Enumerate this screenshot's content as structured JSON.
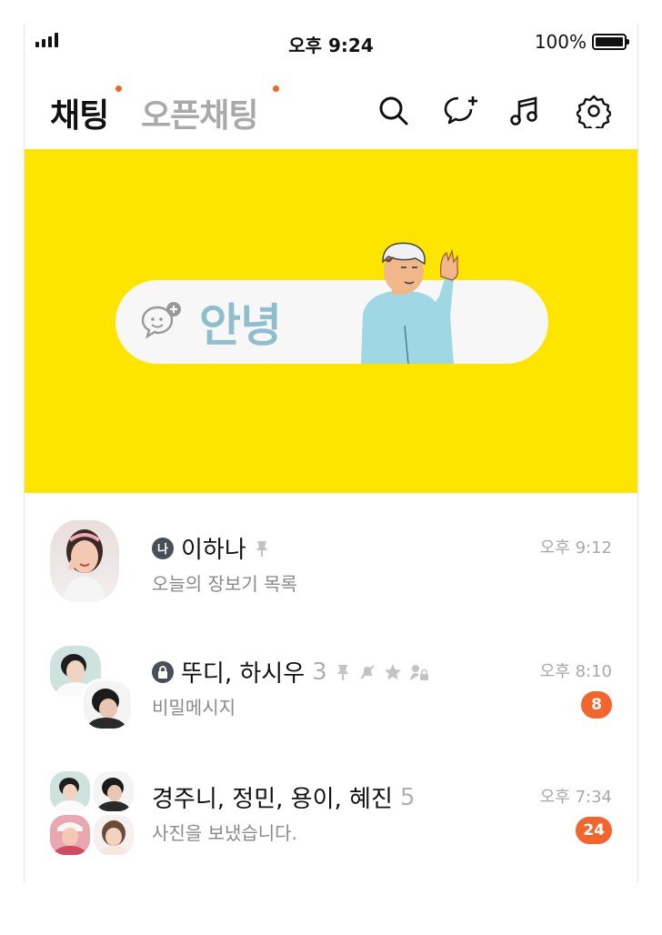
{
  "status_bar": {
    "time": "오후 9:24",
    "battery": "100%"
  },
  "header": {
    "tabs": [
      {
        "label": "채팅",
        "active": true
      },
      {
        "label": "오픈채팅",
        "active": false
      }
    ],
    "icons": [
      "search-icon",
      "new-chat-icon",
      "music-icon",
      "settings-icon"
    ]
  },
  "banner": {
    "greeting": "안녕",
    "background": "#fee500"
  },
  "chats": [
    {
      "name": "이하나",
      "prefix_badge": "나",
      "preview": "오늘의 장보기 목록",
      "time": "오후 9:12",
      "icons": [
        "pin-icon"
      ]
    },
    {
      "name": "뚜디, 하시우",
      "member_count": "3",
      "preview": "비밀메시지",
      "time": "오후 8:10",
      "unread": "8",
      "icons": [
        "lock-icon",
        "pin-icon",
        "mute-icon",
        "favorite-icon",
        "secret-icon"
      ]
    },
    {
      "name": "경주니, 정민, 용이, 혜진",
      "member_count": "5",
      "preview": "사진을 보냈습니다.",
      "time": "오후 7:34",
      "unread": "24"
    }
  ],
  "colors": {
    "accent": "#f2652d",
    "brand_yellow": "#fee500",
    "greeting_text": "#8fbfcc"
  }
}
